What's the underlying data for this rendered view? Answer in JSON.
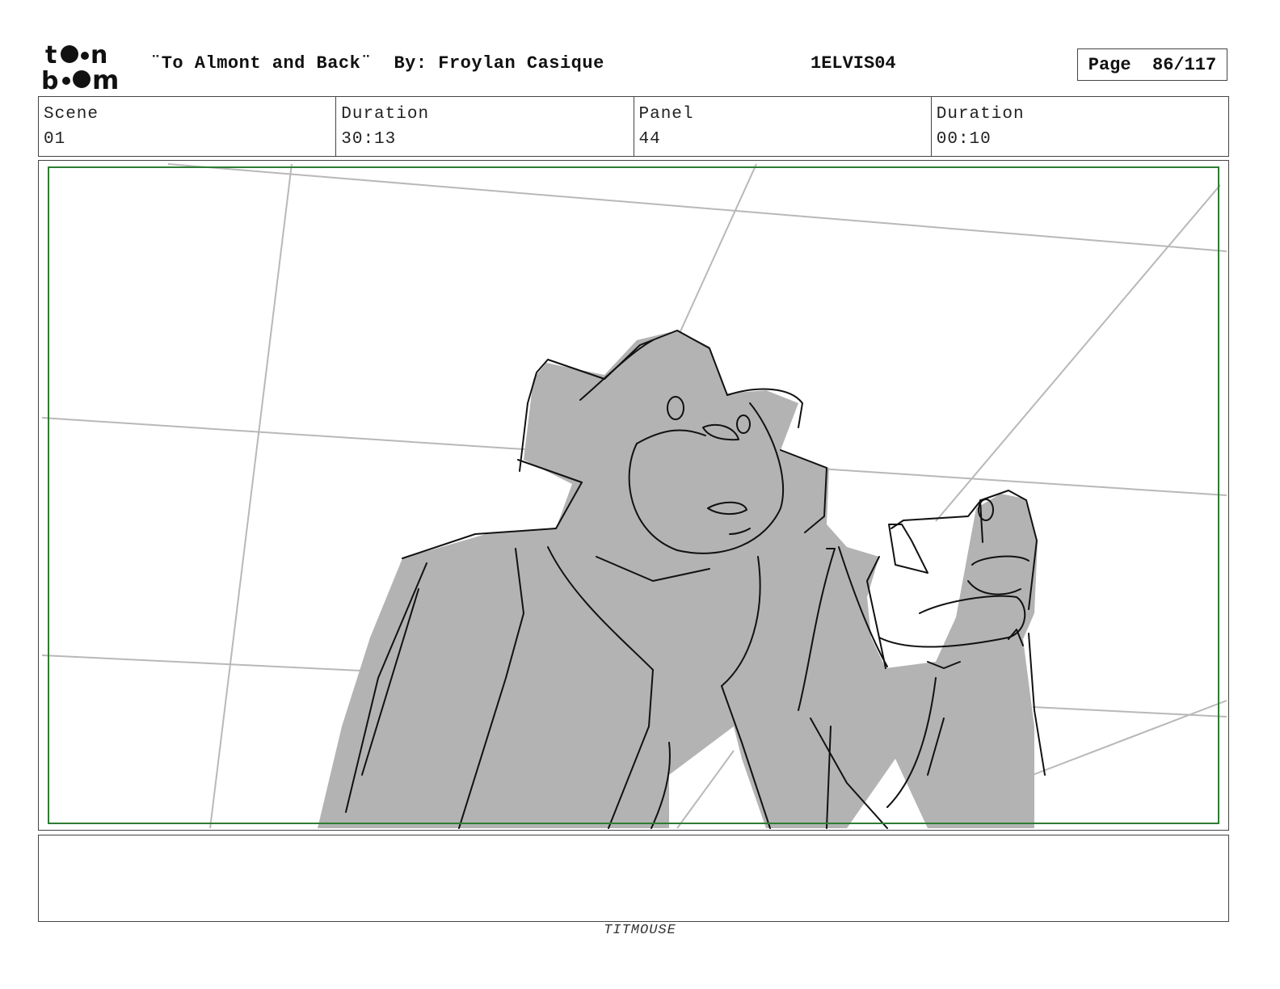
{
  "logo": {
    "line1": "toon",
    "line2": "boom",
    "icon": "toon-boom-logo"
  },
  "header": {
    "title": "¨To Almont and Back¨  By: Froylan Casique",
    "code": "1ELVIS04",
    "page_label": "Page",
    "page_value": "86/117"
  },
  "info": {
    "scene_label": "Scene",
    "scene_value": "01",
    "duration_label": "Duration",
    "duration_value": "30:13",
    "panel_label": "Panel",
    "panel_value": "44",
    "panel_duration_label": "Duration",
    "panel_duration_value": "00:10"
  },
  "panel": {
    "image": "storyboard-sketch-gorilla-holding-object",
    "safe_frame_color": "#2e7d32",
    "fill_color": "#b3b3b3"
  },
  "notes": {
    "text": ""
  },
  "footer": {
    "studio": "TITMOUSE"
  }
}
